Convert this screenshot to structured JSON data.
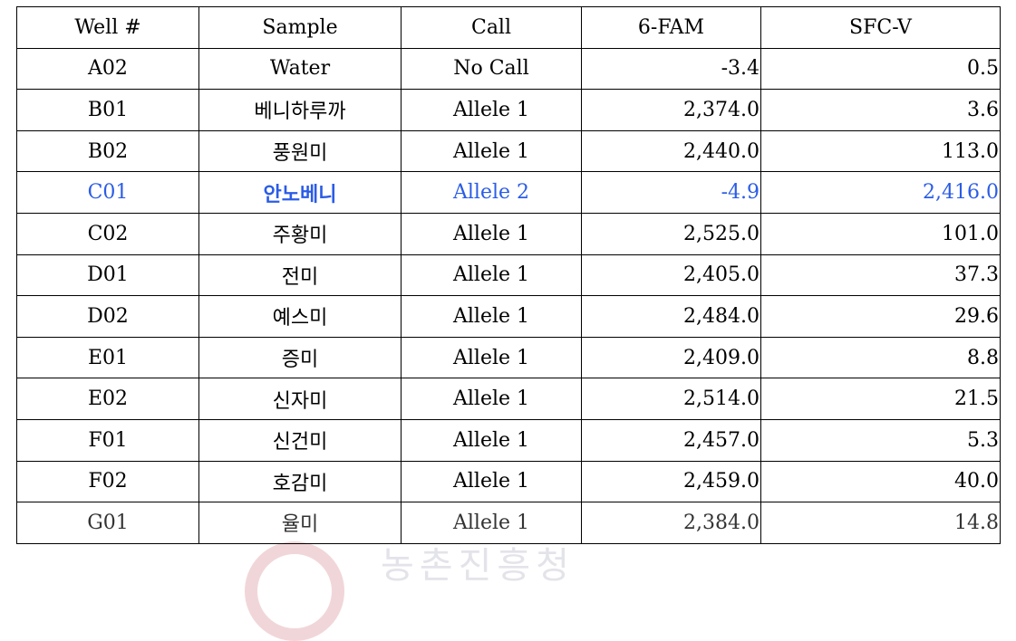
{
  "table": {
    "headers": [
      "Well #",
      "Sample",
      "Call",
      "6-FAM",
      "SFC-V"
    ],
    "highlight_color": "#2b5ce6",
    "rows": [
      {
        "well": "A02",
        "sample": "Water",
        "call": "No Call",
        "fam": "-3.4",
        "sfcv": "0.5",
        "highlight": false
      },
      {
        "well": "B01",
        "sample": "베니하루까",
        "call": "Allele 1",
        "fam": "2,374.0",
        "sfcv": "3.6",
        "highlight": false
      },
      {
        "well": "B02",
        "sample": "풍원미",
        "call": "Allele 1",
        "fam": "2,440.0",
        "sfcv": "113.0",
        "highlight": false
      },
      {
        "well": "C01",
        "sample": "안노베니",
        "call": "Allele 2",
        "fam": "-4.9",
        "sfcv": "2,416.0",
        "highlight": true
      },
      {
        "well": "C02",
        "sample": "주황미",
        "call": "Allele 1",
        "fam": "2,525.0",
        "sfcv": "101.0",
        "highlight": false
      },
      {
        "well": "D01",
        "sample": "전미",
        "call": "Allele 1",
        "fam": "2,405.0",
        "sfcv": "37.3",
        "highlight": false
      },
      {
        "well": "D02",
        "sample": "예스미",
        "call": "Allele 1",
        "fam": "2,484.0",
        "sfcv": "29.6",
        "highlight": false
      },
      {
        "well": "E01",
        "sample": "증미",
        "call": "Allele 1",
        "fam": "2,409.0",
        "sfcv": "8.8",
        "highlight": false
      },
      {
        "well": "E02",
        "sample": "신자미",
        "call": "Allele 1",
        "fam": "2,514.0",
        "sfcv": "21.5",
        "highlight": false
      },
      {
        "well": "F01",
        "sample": "신건미",
        "call": "Allele 1",
        "fam": "2,457.0",
        "sfcv": "5.3",
        "highlight": false
      },
      {
        "well": "F02",
        "sample": "호감미",
        "call": "Allele 1",
        "fam": "2,459.0",
        "sfcv": "40.0",
        "highlight": false
      },
      {
        "well": "G01",
        "sample": "율미",
        "call": "Allele 1",
        "fam": "2,384.0",
        "sfcv": "14.8",
        "highlight": false
      }
    ]
  },
  "watermark": {
    "text": "농촌진흥청"
  }
}
